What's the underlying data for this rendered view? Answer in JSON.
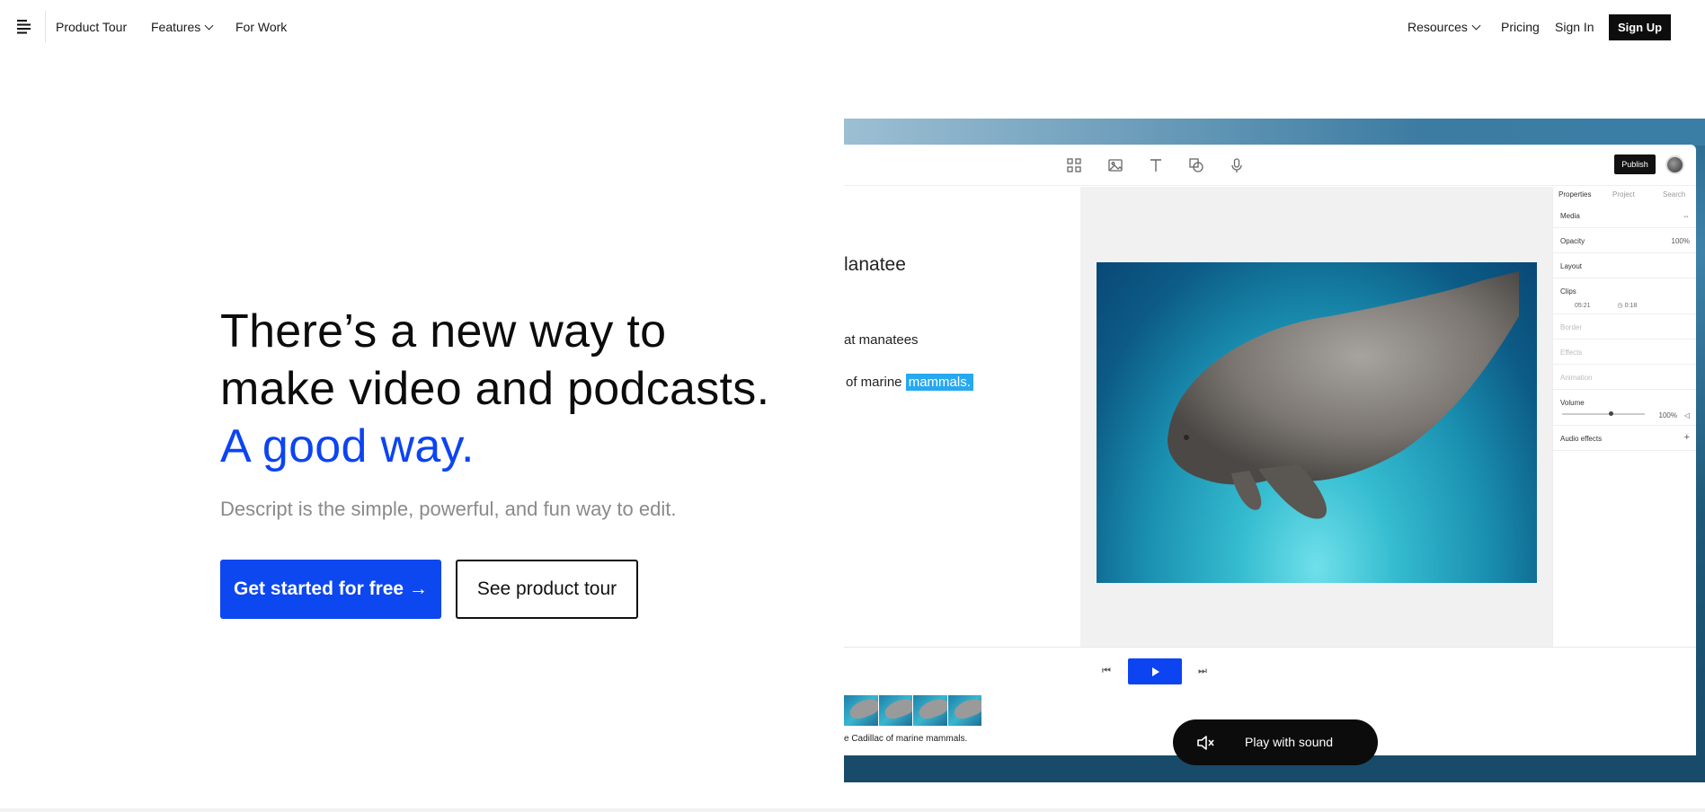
{
  "nav": {
    "product_tour": "Product Tour",
    "features": "Features",
    "for_work": "For Work",
    "resources": "Resources",
    "pricing": "Pricing",
    "sign_in": "Sign In",
    "sign_up": "Sign Up"
  },
  "hero": {
    "title_main": "There’s a new way to make video and podcasts.",
    "title_accent": "A good way.",
    "subtitle": "Descript is the simple, powerful, and fun way to edit.",
    "primary_cta": "Get started for free →",
    "secondary_cta": "See product tour"
  },
  "demo": {
    "publish": "Publish",
    "script": {
      "title": "lanatee",
      "line1": "at manatees",
      "line2_prefix": "of marine",
      "line2_highlight": "mammals."
    },
    "props": {
      "tabs": [
        "Properties",
        "Project",
        "Search"
      ],
      "media": "Media",
      "opacity": "Opacity",
      "opacity_value": "100%",
      "layout": "Layout",
      "clips": "Clips",
      "clip_start": "05:21",
      "clip_length": "0:18",
      "border": "Border",
      "effects": "Effects",
      "animation": "Animation",
      "volume": "Volume",
      "volume_value": "100%",
      "audio_effects": "Audio effects"
    },
    "caption": "e Cadillac of marine mammals.",
    "play_with_sound": "Play with sound"
  },
  "colors": {
    "accent": "#0d44f2",
    "highlight": "#27a9f0",
    "dark": "#0c0c0c"
  }
}
